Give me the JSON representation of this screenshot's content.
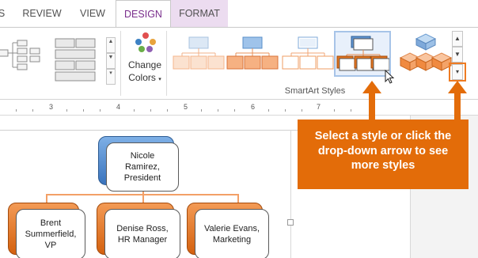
{
  "tabs": {
    "cut_label": "S",
    "review": "REVIEW",
    "view": "VIEW",
    "design": "DESIGN",
    "format": "FORMAT"
  },
  "change_colors": {
    "line1": "Change",
    "line2": "Colors"
  },
  "smartart_styles": {
    "group_label": "SmartArt Styles",
    "selected_index": 3
  },
  "ruler": {
    "numbers": [
      "3",
      "4",
      "5",
      "6",
      "7"
    ]
  },
  "org_chart": {
    "top": "Nicole Ramirez, President",
    "top_lines": [
      "Nicole",
      "Ramirez,",
      "President"
    ],
    "children": [
      {
        "lines": [
          "Brent",
          "Summerfield,",
          "VP"
        ]
      },
      {
        "lines": [
          "Denise Ross,",
          "HR Manager"
        ]
      },
      {
        "lines": [
          "Valerie Evans,",
          "Marketing"
        ]
      }
    ]
  },
  "callout": {
    "lines": [
      "Select a style or click the",
      "drop-down arrow to see",
      "more styles"
    ]
  },
  "colors": {
    "accent_orange": "#e36c09",
    "tab_accent": "#7a2e8c",
    "selection_blue": "#a7c4e8"
  }
}
